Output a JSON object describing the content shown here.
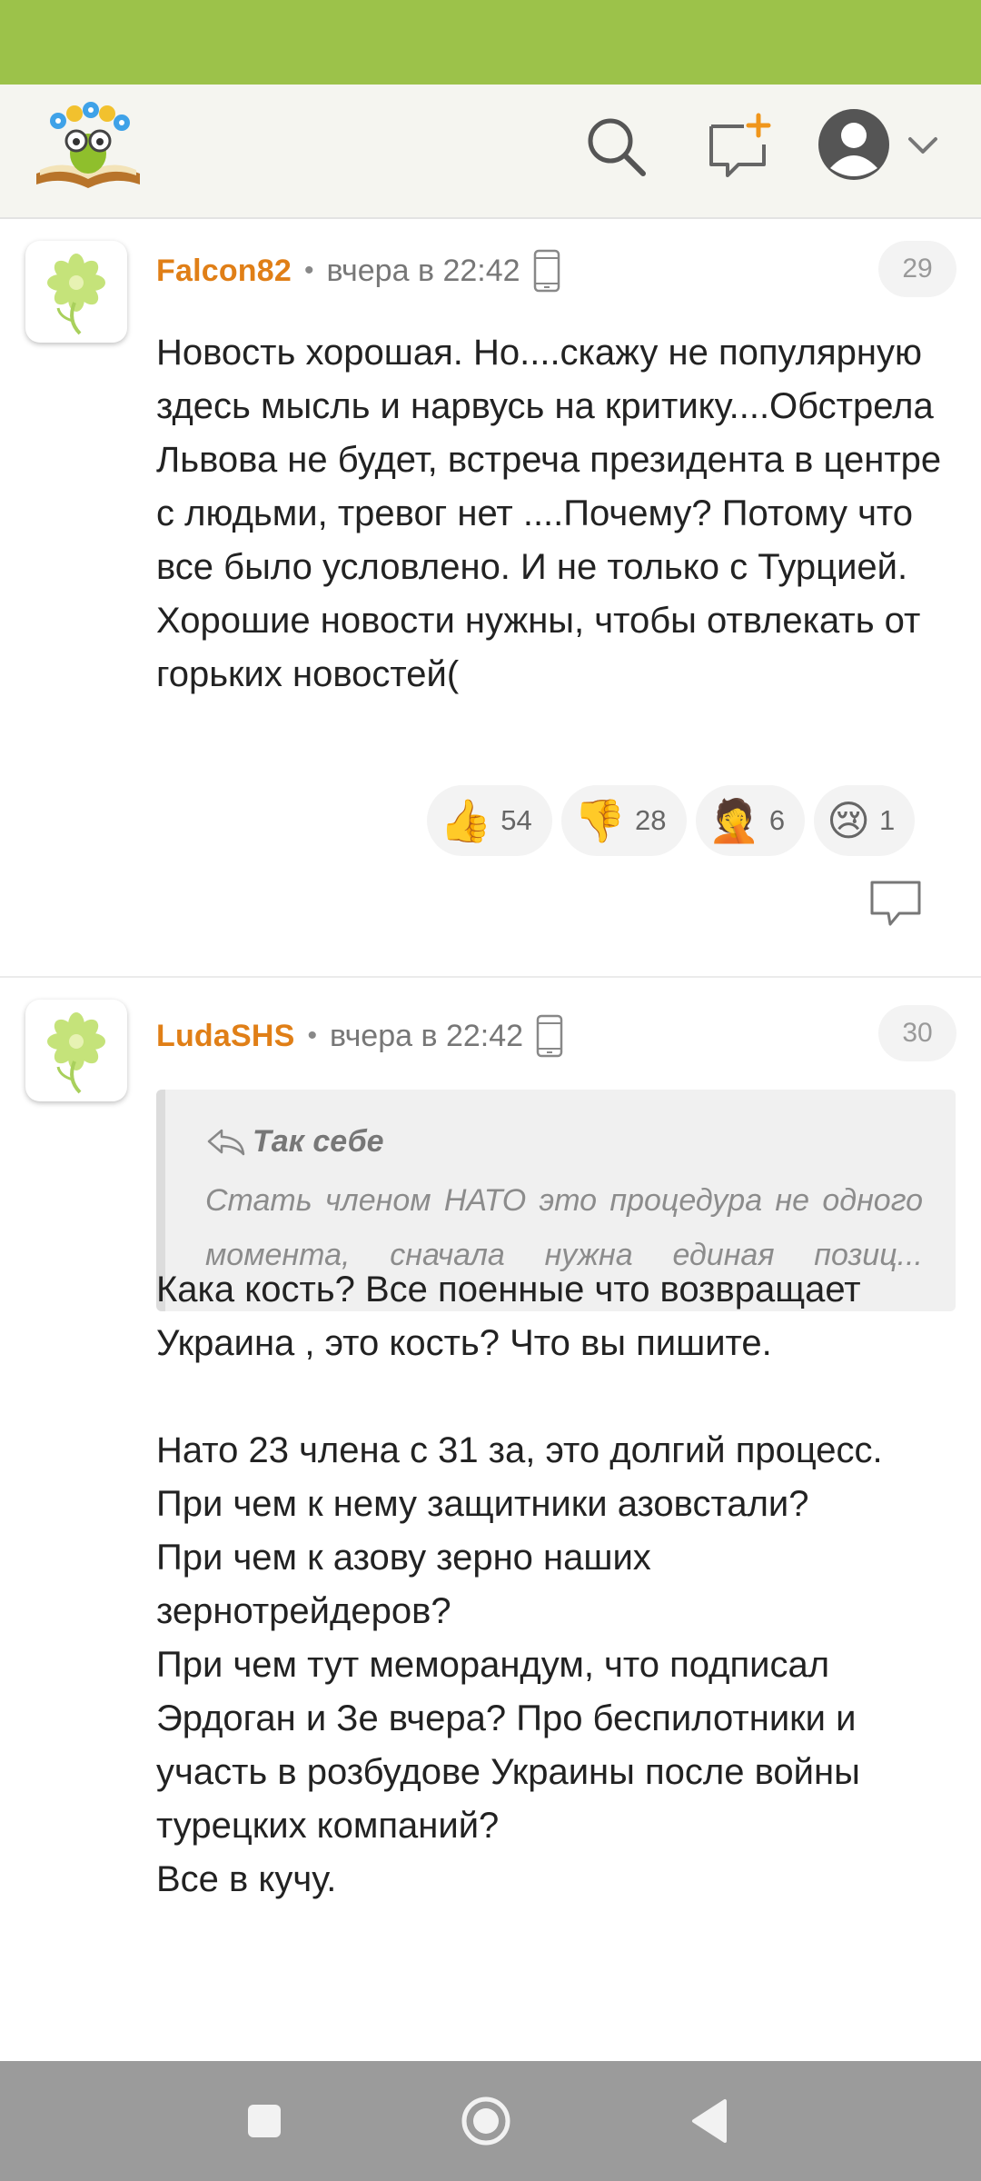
{
  "header": {
    "logo_icon": "reading-flower-logo",
    "search_icon": "search-icon",
    "new_post_icon": "new-post-icon",
    "profile_icon": "profile-avatar-icon",
    "menu_icon": "chevron-down-icon"
  },
  "comments": [
    {
      "author": "Falcon82",
      "separator": "•",
      "time": "вчера в 22:42",
      "device_icon": "mobile-phone-icon",
      "number": "29",
      "text": "Новость хорошая. Но....скажу не популярную здесь мысль и нарвусь на критику....Обстрела Львова не будет, встреча президента в центре с людьми, тревог нет ....Почему? Потому что все было условлено. И не только с Турцией. Хорошие новости нужны, чтобы отвлекать от горьких новостей(",
      "reactions": [
        {
          "emoji": "👍",
          "name": "thumbs-up",
          "count": "54"
        },
        {
          "emoji": "👎",
          "name": "thumbs-down",
          "count": "28"
        },
        {
          "emoji": "🤦",
          "name": "facepalm",
          "count": "6"
        },
        {
          "emoji": "😢",
          "name": "crying",
          "count": "1"
        }
      ],
      "reply_icon": "reply-bubble-icon"
    },
    {
      "author": "LudaSHS",
      "separator": "•",
      "time": "вчера в 22:42",
      "device_icon": "mobile-phone-icon",
      "number": "30",
      "quote": {
        "author": "Так себе",
        "text": "Стать членом НАТО это процедура не одного момента, сначала нужна единая позиц..."
      },
      "text": "Кака кость? Все поенные что возвращает Украина , это кость? Что вы пишите.\n\nНато 23 члена с 31 за, это долгий процесс.\nПри чем к нему защитники азовстали?\nПри чем к азову зерно наших зернотрейдеров?\nПри чем тут меморандум, что подписал Эрдоган и Зе вчера? Про беспилотники и участь в розбудове Украины после войны турецких компаний?\nВсе в кучу."
    }
  ],
  "nav": {
    "recents_icon": "square-icon",
    "home_icon": "circle-home-icon",
    "back_icon": "triangle-back-icon"
  },
  "colors": {
    "status_bar": "#9cc24a",
    "username": "#e07f17",
    "nav_bar": "#9b9b9b"
  }
}
